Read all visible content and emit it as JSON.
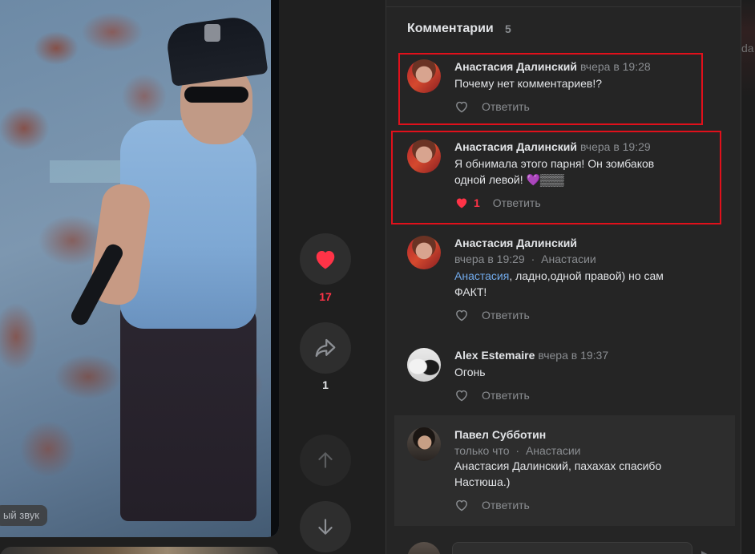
{
  "video": {
    "sound_label": "ый звук"
  },
  "rail": {
    "likes_count": "17",
    "shares_count": "1"
  },
  "comments_panel": {
    "title": "Комментарии",
    "count": "5",
    "items": [
      {
        "author": "Анастасия Далинский",
        "time": "вчера в 19:28",
        "text": "Почему нет комментариев!?",
        "reply_label": "Ответить",
        "liked": false
      },
      {
        "author": "Анастасия Далинский",
        "time": "вчера в 19:29",
        "text_line1": "Я обнимала этого парня! Он зомбаков",
        "text_line2": "одной левой! 💜▒▒▒",
        "like_count": "1",
        "reply_label": "Ответить",
        "liked": true
      },
      {
        "author": "Анастасия Далинский",
        "time": "вчера в 19:29",
        "reply_to": "Анастасии",
        "mention": "Анастасия",
        "text_rest": ", ладно,одной правой) но сам",
        "text_line2": "ФАКТ!",
        "reply_label": "Ответить",
        "liked": false
      },
      {
        "author": "Alex Estemaire",
        "time": "вчера в 19:37",
        "text": "Огонь",
        "reply_label": "Ответить",
        "liked": false
      },
      {
        "author": "Павел Субботин",
        "time": "только что",
        "reply_to": "Анастасии",
        "text_line1": "Анастасия Далинский, пахахах спасибо",
        "text_line2": "Настюша.)",
        "reply_label": "Ответить",
        "liked": false
      }
    ],
    "separator": "·"
  },
  "right_edge": {
    "partial_text": "da"
  },
  "colors": {
    "background": "#1f1f1f",
    "panel": "#252525",
    "like_red": "#ff3347",
    "highlight_red": "#e0101b",
    "mention_blue": "#71aaeb",
    "secondary_text": "#8a8d91"
  },
  "icons": [
    "heart-icon",
    "share-arrow-icon",
    "arrow-up-icon",
    "arrow-down-icon",
    "heart-outline-icon",
    "heart-filled-icon",
    "purple-heart-emoji"
  ]
}
